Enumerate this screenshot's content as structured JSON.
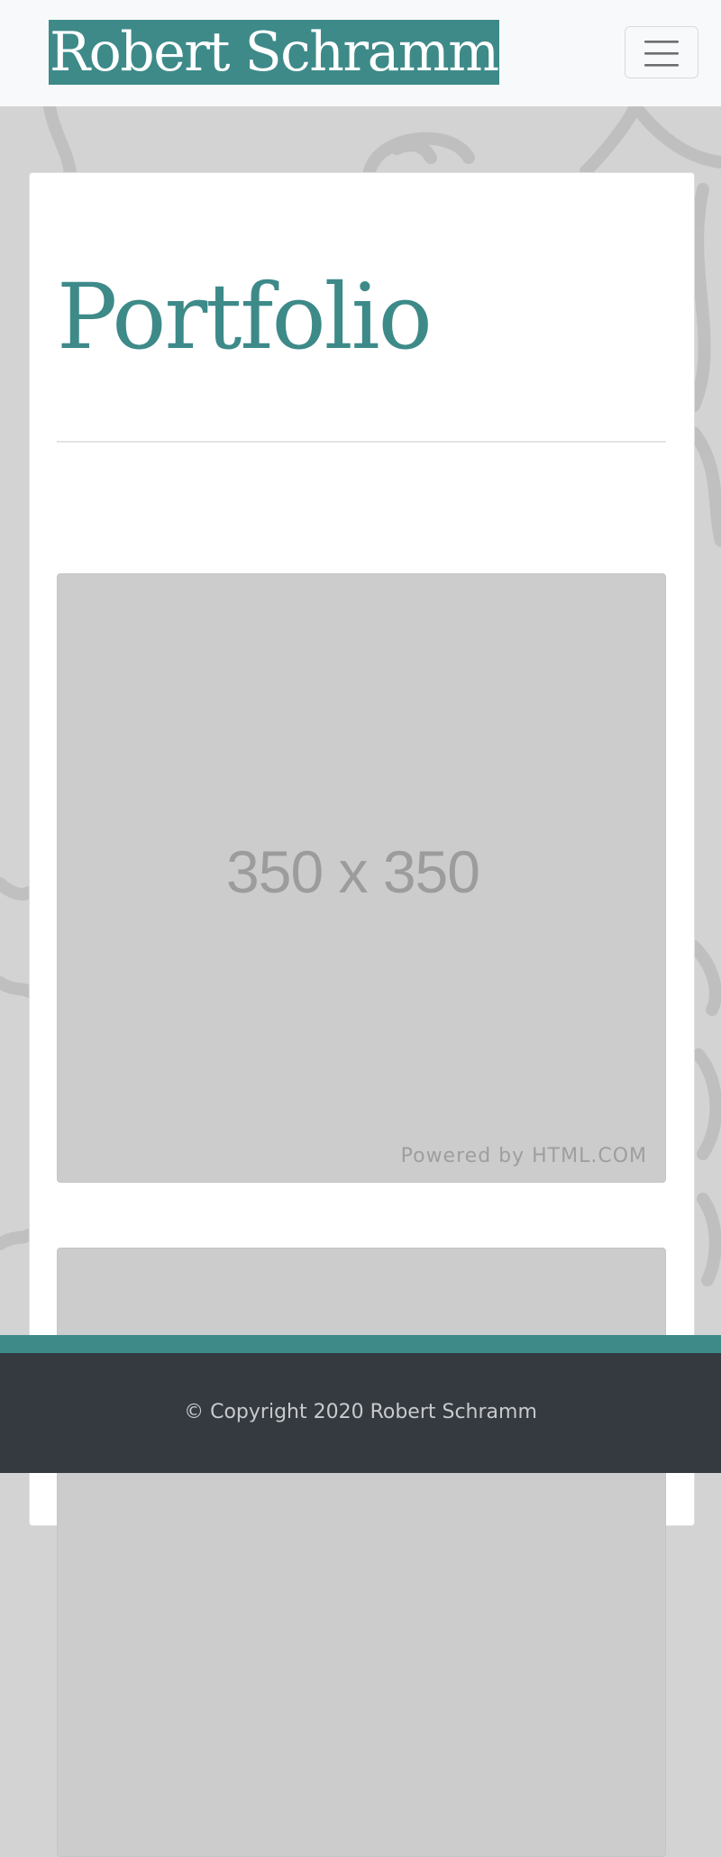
{
  "navbar": {
    "brand": "Robert Schramm",
    "toggler_icon": "hamburger-menu-icon"
  },
  "main": {
    "title": "Portfolio",
    "items": [
      {
        "placeholder_text": "350 x 350",
        "credit": "Powered by HTML.COM"
      },
      {
        "placeholder_text": "",
        "credit": ""
      }
    ]
  },
  "footer": {
    "copyright": "© Copyright 2020 Robert Schramm"
  },
  "colors": {
    "accent": "#3d8a89",
    "navbar_bg": "#f8f9fa",
    "footer_bg": "#343a40",
    "page_bg": "#d3d3d3",
    "placeholder_bg": "#cccccc"
  }
}
